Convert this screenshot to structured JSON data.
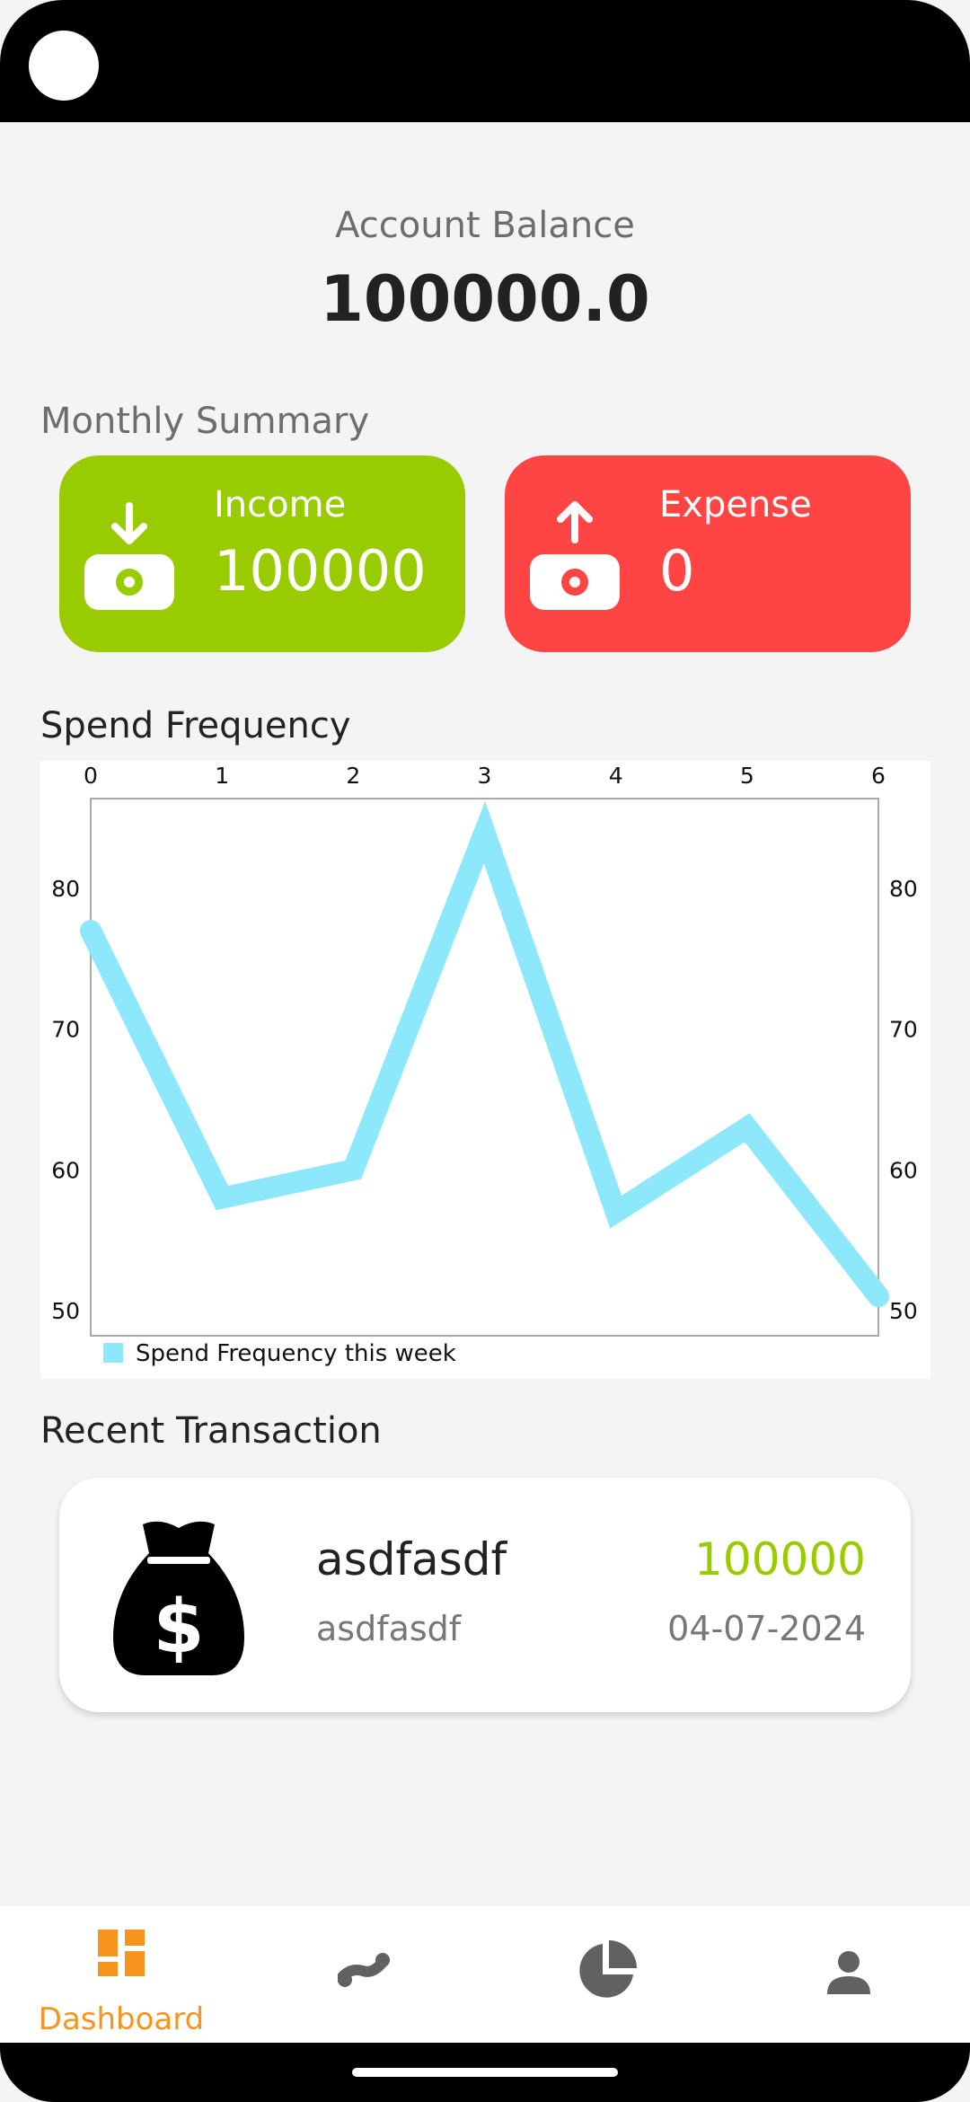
{
  "balance": {
    "label": "Account Balance",
    "value": "100000.0"
  },
  "summary": {
    "title": "Monthly Summary",
    "income": {
      "label": "Income",
      "value": "100000",
      "color": "#98cb00",
      "icon": "money-in-icon"
    },
    "expense": {
      "label": "Expense",
      "value": "0",
      "color": "#ff4444",
      "icon": "money-out-icon"
    }
  },
  "chart_section": {
    "title": "Spend Frequency"
  },
  "chart_data": {
    "type": "line",
    "x": [
      0,
      1,
      2,
      3,
      4,
      5,
      6
    ],
    "series": [
      {
        "name": "Spend Frequency this week",
        "values": [
          77,
          58,
          60,
          84,
          57,
          63,
          51
        ],
        "color": "#8de8fb"
      }
    ],
    "xticks": [
      "0",
      "1",
      "2",
      "3",
      "4",
      "5",
      "6"
    ],
    "yticks": [
      "50",
      "60",
      "70",
      "80"
    ],
    "xlim": [
      0,
      6
    ],
    "ylim": [
      48.2,
      86.4
    ],
    "legend_position": "bottom-left",
    "x_axis_position": "top",
    "y_axis_position": "both"
  },
  "recent": {
    "title": "Recent Transaction",
    "transaction": {
      "title": "asdfasdf",
      "description": "asdfasdf",
      "amount": "100000",
      "date": "04-07-2024",
      "icon": "money-bag-icon",
      "amount_color": "#98cb00"
    }
  },
  "nav": {
    "items": [
      {
        "label": "Dashboard",
        "icon": "dashboard-icon",
        "active": true
      },
      {
        "label": "",
        "icon": "transactions-icon",
        "active": false
      },
      {
        "label": "",
        "icon": "pie-chart-icon",
        "active": false
      },
      {
        "label": "",
        "icon": "profile-icon",
        "active": false
      }
    ],
    "active_color": "#f7941d",
    "inactive_color": "#616161"
  }
}
